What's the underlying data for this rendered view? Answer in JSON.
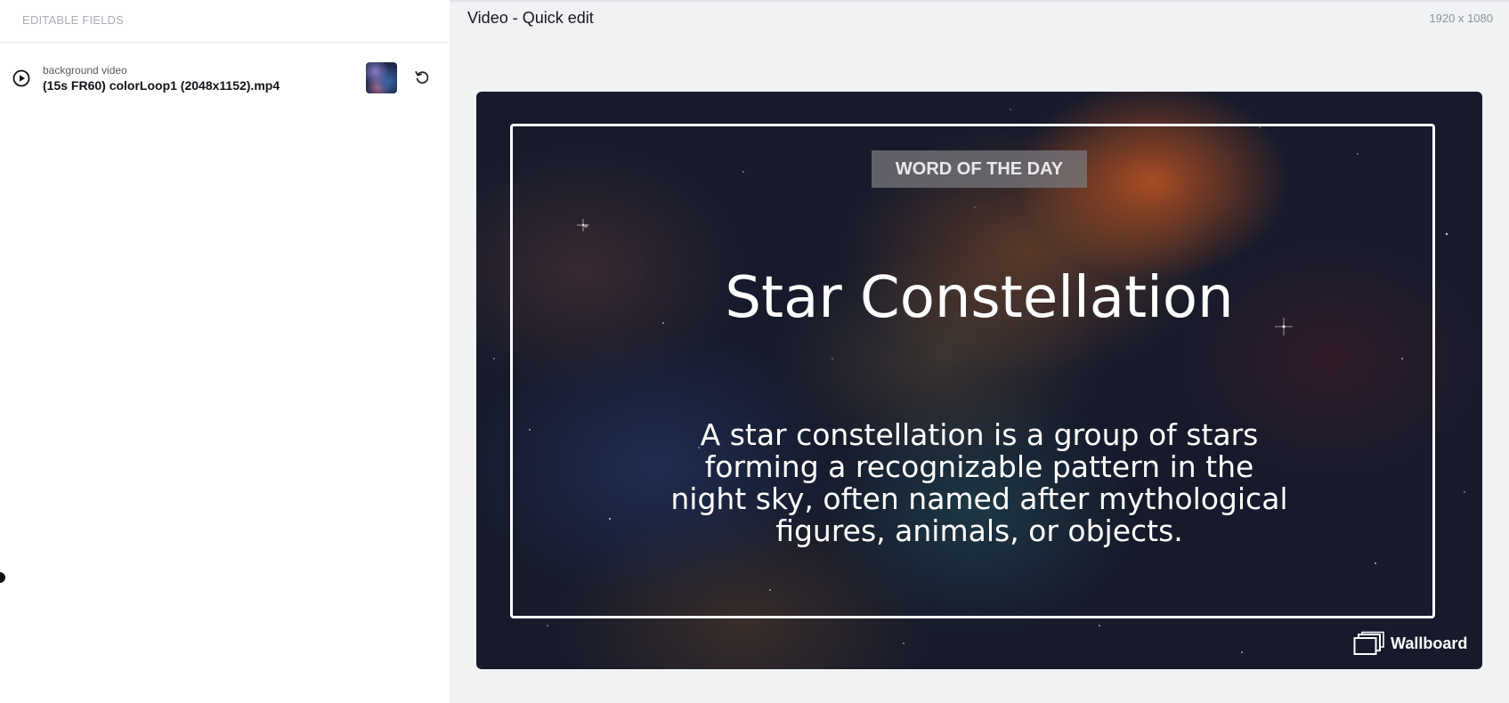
{
  "left_panel": {
    "header_label": "EDITABLE FIELDS",
    "fields": [
      {
        "label": "background video",
        "value": "(15s FR60) colorLoop1 (2048x1152).mp4",
        "icon": "play-circle-icon",
        "action_icon": "reset-icon"
      }
    ]
  },
  "editor": {
    "title": "Video - Quick edit",
    "resolution": "1920 x 1080"
  },
  "canvas": {
    "badge": "WORD OF THE DAY",
    "headline": "Star Constellation",
    "description": "A star constellation is a group of stars forming a recognizable pattern in the night sky, often named after mythological figures, animals, or objects.",
    "brand_name": "Wallboard",
    "frame_color": "#ffffff"
  }
}
